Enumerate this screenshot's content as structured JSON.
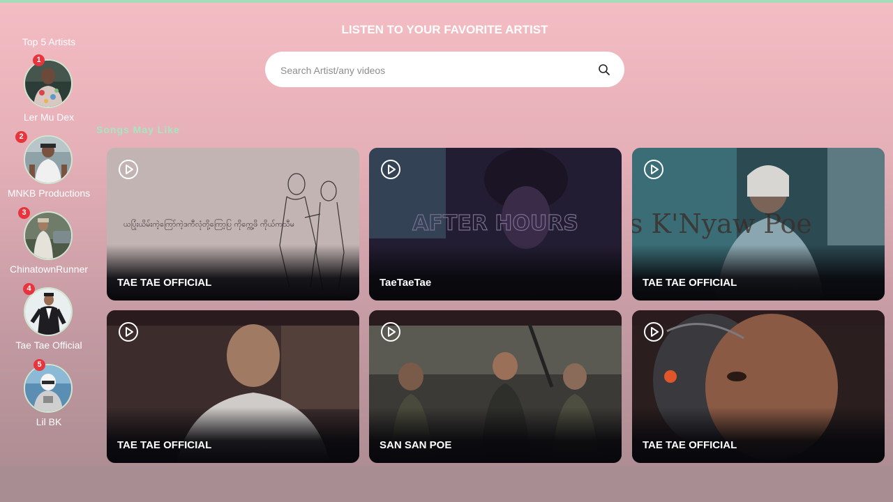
{
  "header": {
    "title": "LISTEN TO YOUR FAVORITE ARTIST"
  },
  "search": {
    "placeholder": "Search Artist/any videos",
    "value": "",
    "icon": "search-icon"
  },
  "sidebar": {
    "title": "Top 5 Artists",
    "artists": [
      {
        "rank": "1",
        "name": "Ler Mu Dex"
      },
      {
        "rank": "2",
        "name": "MNKB Productions"
      },
      {
        "rank": "3",
        "name": "ChinatownRunner"
      },
      {
        "rank": "4",
        "name": "Tae Tae Official"
      },
      {
        "rank": "5",
        "name": "Lil BK"
      }
    ]
  },
  "songs": {
    "title": "Songs May Like",
    "items": [
      {
        "label": "TAE TAE OFFICIAL",
        "thumb_text": "ယပြုံးယိမ်းကဲ့ကြော်ကဲ့ဒကီလုံတို့ကြော့ပြ ကိုက္ကေ့ဖိ ကိုယ်ကသီမ"
      },
      {
        "label": "TaeTaeTae",
        "thumb_text": "AFTER HOURS"
      },
      {
        "label": "TAE TAE OFFICIAL",
        "thumb_text": "s K'Nyaw Poe"
      },
      {
        "label": "TAE TAE OFFICIAL",
        "thumb_text": ""
      },
      {
        "label": "SAN SAN POE",
        "thumb_text": ""
      },
      {
        "label": "TAE TAE OFFICIAL",
        "thumb_text": ""
      }
    ]
  },
  "colors": {
    "accent_green": "#a6e6c1",
    "badge_red": "#e8343c",
    "background_top": "#f4bcc3",
    "background_bottom": "#a88a8f"
  }
}
